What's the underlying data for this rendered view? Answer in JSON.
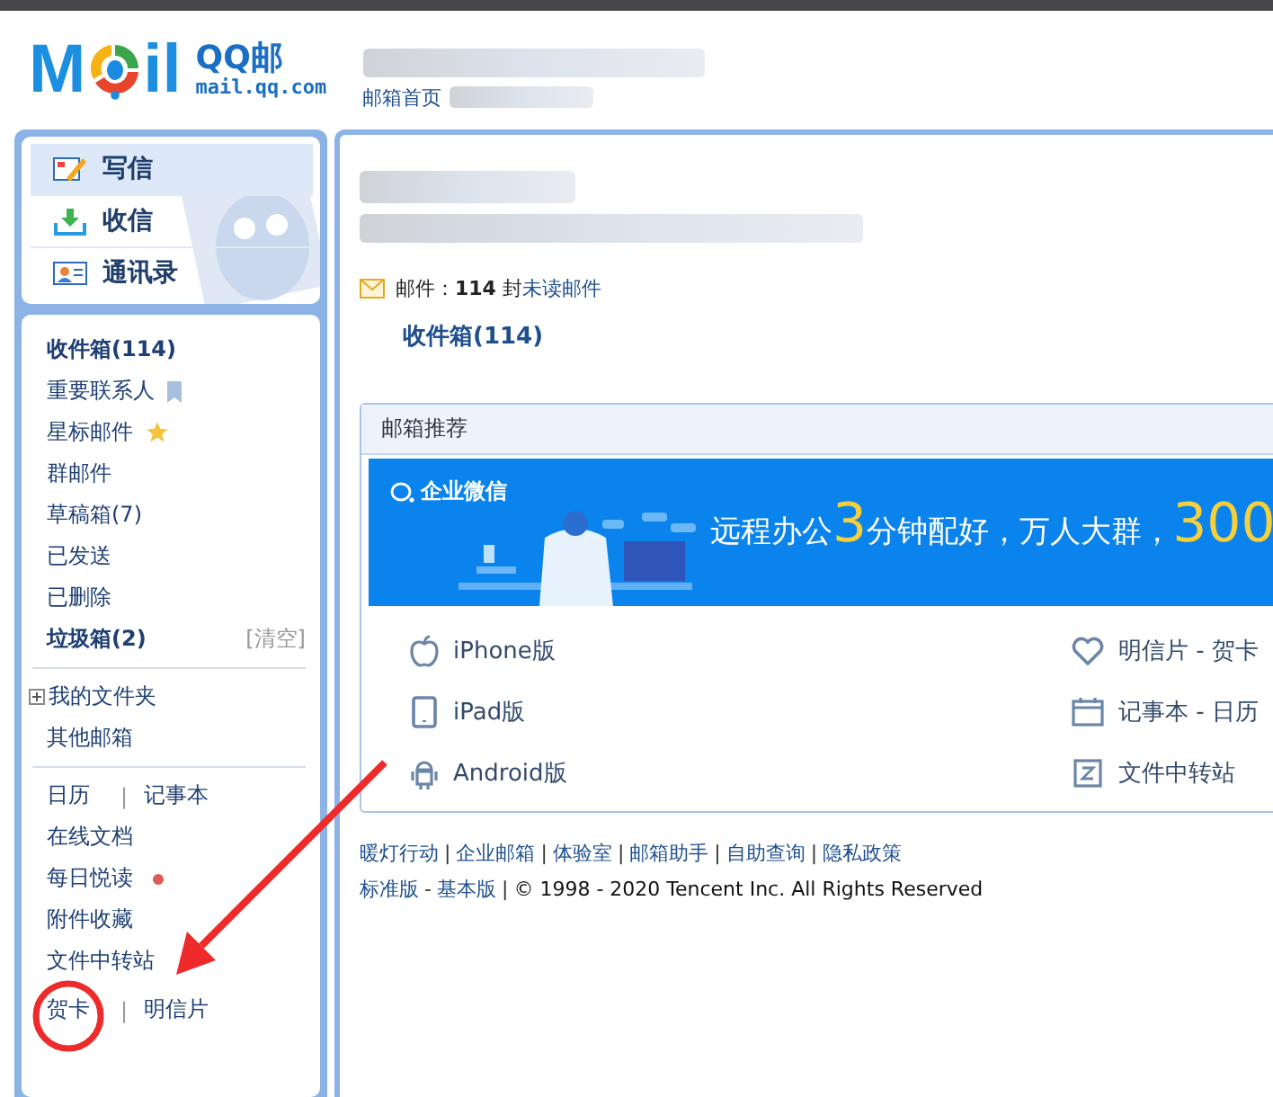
{
  "header": {
    "logo_left": "M",
    "logo_right": "il",
    "product": "QQ邮",
    "domain": "mail.qq.com",
    "nav": [
      {
        "label": "邮箱首页"
      }
    ]
  },
  "sidebar": {
    "actions": [
      {
        "label": "写信",
        "kind": "compose",
        "selected": true
      },
      {
        "label": "收信",
        "kind": "receive",
        "selected": false
      },
      {
        "label": "通讯录",
        "kind": "contacts",
        "selected": false
      }
    ],
    "groups": [
      [
        {
          "kind": "plain",
          "label": "收件箱(114)",
          "unread": true
        },
        {
          "kind": "flag",
          "label": "重要联系人",
          "unread": false
        },
        {
          "kind": "star",
          "label": "星标邮件",
          "unread": false
        },
        {
          "kind": "plain",
          "label": "群邮件",
          "unread": false
        },
        {
          "kind": "plain",
          "label": "草稿箱(7)",
          "unread": false
        },
        {
          "kind": "plain",
          "label": "已发送",
          "unread": false
        },
        {
          "kind": "plain",
          "label": "已删除",
          "unread": false
        },
        {
          "kind": "plain",
          "label": "垃圾箱(2)",
          "unread": true,
          "action": "[清空]"
        }
      ],
      [
        {
          "kind": "tree",
          "label": "我的文件夹",
          "expanded": false
        },
        {
          "kind": "plain",
          "label": "其他邮箱",
          "unread": false
        }
      ],
      [
        {
          "kind": "pair",
          "labels": [
            "日历",
            "记事本"
          ],
          "separator": "|"
        },
        {
          "kind": "plain",
          "label": "在线文档",
          "unread": false
        },
        {
          "kind": "dot",
          "label": "每日悦读",
          "unread": false,
          "color": "#e05a5a"
        },
        {
          "kind": "plain",
          "label": "附件收藏",
          "unread": false
        },
        {
          "kind": "plain",
          "label": "文件中转站",
          "unread": false
        },
        {
          "kind": "pair",
          "labels": [
            "贺卡",
            "明信片"
          ],
          "separator": "|"
        }
      ]
    ]
  },
  "main": {
    "mail_summary": "邮件：**114** 封",
    "unread_link": "未读邮件",
    "inbox_link": "收件箱(114)",
    "recommend": {
      "title": "邮箱推荐",
      "banner": {
        "brand": "企业微信",
        "headline": [
          {
            "text": "远程办公",
            "highlight": false
          },
          {
            "text": "3",
            "highlight": true
          },
          {
            "text": "分钟配好，万人大群，",
            "highlight": false
          },
          {
            "text": "300",
            "highlight": true
          }
        ]
      },
      "apps_left": [
        {
          "kind": "apple",
          "label": "iPhone版"
        },
        {
          "kind": "tablet",
          "label": "iPad版"
        },
        {
          "kind": "android",
          "label": "Android版"
        }
      ],
      "apps_right": [
        {
          "kind": "heart",
          "label": "明信片 - 贺卡"
        },
        {
          "kind": "calendar",
          "label": "记事本 - 日历"
        },
        {
          "kind": "transfer",
          "label": "文件中转站"
        }
      ]
    },
    "footer_links": [
      {
        "label": "暖灯行动"
      },
      {
        "sep": "|",
        "label": "企业邮箱"
      },
      {
        "sep": "|",
        "label": "体验室"
      },
      {
        "sep": "|",
        "label": "邮箱助手"
      },
      {
        "sep": "|",
        "label": "自助查询"
      },
      {
        "sep": "|",
        "label": "隐私政策"
      }
    ],
    "footer_versions": [
      {
        "label": "标准版"
      },
      {
        "sep": "-",
        "label": "基本版"
      }
    ],
    "copyright_sep": "|",
    "copyright": "© 1998 - 2020 Tencent Inc. All Rights Reserved"
  }
}
